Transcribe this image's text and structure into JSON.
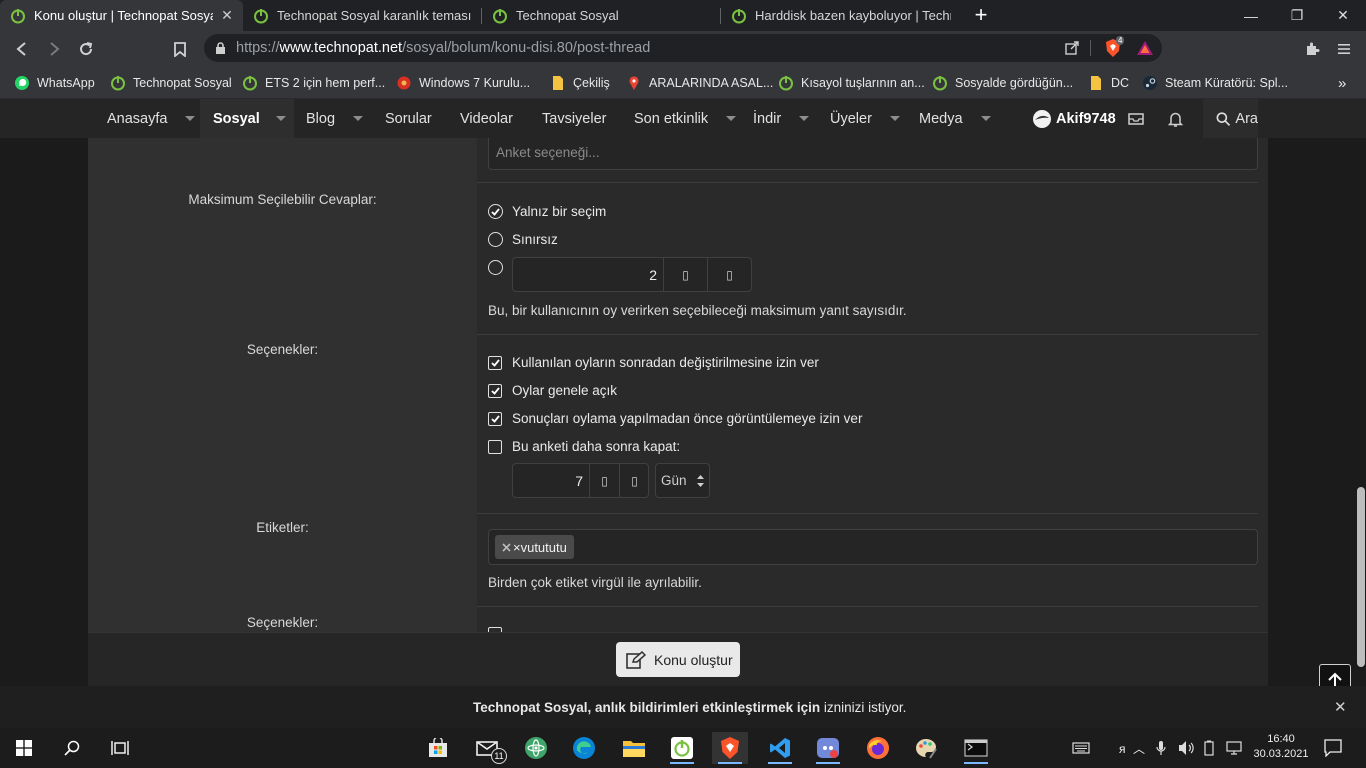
{
  "browser": {
    "tabs": [
      {
        "title": "Konu oluştur | Technopat Sosyal",
        "active": true
      },
      {
        "title": "Technopat Sosyal karanlık teması için g",
        "active": false
      },
      {
        "title": "Technopat Sosyal",
        "active": false
      },
      {
        "title": "Harddisk bazen kayboluyor | Technopat",
        "active": false
      }
    ],
    "new_tab": "+",
    "window": {
      "minimize": "—",
      "maximize": "❐",
      "close": "✕"
    },
    "url": {
      "scheme": "https://",
      "host": "www.technopat.net",
      "path": "/sosyal/bolum/konu-disi.80/post-thread"
    },
    "shields_count": "4",
    "bookmarks": [
      "WhatsApp",
      "Technopat Sosyal",
      "ETS 2 için hem perf...",
      "Windows 7 Kurulu...",
      "Çekiliş",
      "ARALARINDA ASAL...",
      "Kısayol tuşlarının an...",
      "Sosyalde gördüğün...",
      "DC",
      "Steam Küratörü: Spl..."
    ],
    "more_bookmarks": "»"
  },
  "site": {
    "nav": [
      {
        "label": "Anasayfa",
        "caret": true
      },
      {
        "label": "Sosyal",
        "caret": true,
        "active": true
      },
      {
        "label": "Blog",
        "caret": true
      },
      {
        "label": "Sorular",
        "caret": false
      },
      {
        "label": "Videolar",
        "caret": false
      },
      {
        "label": "Tavsiyeler",
        "caret": false
      },
      {
        "label": "Son etkinlik",
        "caret": true
      },
      {
        "label": "İndir",
        "caret": true
      },
      {
        "label": "Üyeler",
        "caret": true
      },
      {
        "label": "Medya",
        "caret": true
      }
    ],
    "username": "Akif9748",
    "search": "Ara"
  },
  "form": {
    "poll_option_placeholder": "Anket seçeneği...",
    "max_label": "Maksimum Seçilebilir Cevaplar:",
    "max_options": {
      "single": "Yalnız bir seçim",
      "unlimited": "Sınırsız"
    },
    "max_value": "2",
    "max_hint": "Bu, bir kullanıcının oy verirken seçebileceği maksimum yanıt sayısıdır.",
    "options_label": "Seçenekler:",
    "checkboxes": [
      {
        "label": "Kullanılan oyların sonradan değiştirilmesine izin ver",
        "checked": true
      },
      {
        "label": "Oylar genele açık",
        "checked": true
      },
      {
        "label": "Sonuçları oylama yapılmadan önce görüntülemeye izin ver",
        "checked": true
      },
      {
        "label": "Bu anketi daha sonra kapat:",
        "checked": false
      }
    ],
    "close_value": "7",
    "close_unit": "Gün",
    "tags_label": "Etiketler:",
    "tag": "×vutututu",
    "tags_hint": "Birden çok etiket virgül ile ayrılabilir.",
    "options_label_2": "Seçenekler:",
    "submit": "Konu oluştur"
  },
  "notification": {
    "text_bold": "Technopat Sosyal, anlık bildirimleri etkinleştirmek için",
    "text_rest": "izninizi istiyor."
  },
  "taskbar": {
    "time": "16:40",
    "date": "30.03.2021",
    "mail_badge": "11",
    "lang": "я"
  },
  "colors": {
    "accent_green": "#7ac142",
    "brave_orange": "#fb542b"
  }
}
